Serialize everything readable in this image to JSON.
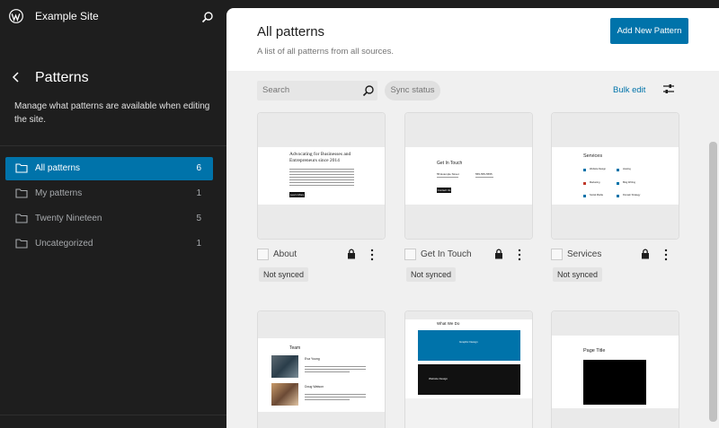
{
  "site": {
    "name": "Example Site"
  },
  "sidebar": {
    "title": "Patterns",
    "description": "Manage what patterns are available when editing the site.",
    "items": [
      {
        "label": "All patterns",
        "count": "6",
        "active": true
      },
      {
        "label": "My patterns",
        "count": "1"
      },
      {
        "label": "Twenty Nineteen",
        "count": "5"
      },
      {
        "label": "Uncategorized",
        "count": "1"
      }
    ]
  },
  "main": {
    "title": "All patterns",
    "subtitle": "A list of all patterns from all sources.",
    "add_button": "Add New Pattern",
    "search_placeholder": "Search",
    "sync_filter": "Sync status",
    "bulk_edit": "Bulk edit"
  },
  "cards": [
    {
      "name": "About",
      "status": "Not synced"
    },
    {
      "name": "Get In Touch",
      "status": "Not synced"
    },
    {
      "name": "Services",
      "status": "Not synced"
    }
  ],
  "previews": {
    "about_heading": "Advocating for Businesses and Entrepreneurs since 2014",
    "about_button": "Learn More",
    "contact_heading": "Get In Touch",
    "contact_address": "55 Example Street",
    "contact_phone": "555-555-5555",
    "contact_button": "Contact Us",
    "services_heading": "Services",
    "services_items": [
      "Website Design",
      "Hosting",
      "Marketing",
      "Blog Writing",
      "Social Media",
      "Domain Strategy"
    ],
    "team_heading": "Team",
    "team_member_1": "Eva Young",
    "team_member_2": "Doug Watson",
    "whatwedo_heading": "What We Do",
    "whatwedo_blue": "Graphic Design",
    "whatwedo_dark": "Website Design",
    "pagetitle_heading": "Page Title"
  },
  "colors": {
    "accent": "#0073aa",
    "sidebar_bg": "#1e1e1e"
  }
}
